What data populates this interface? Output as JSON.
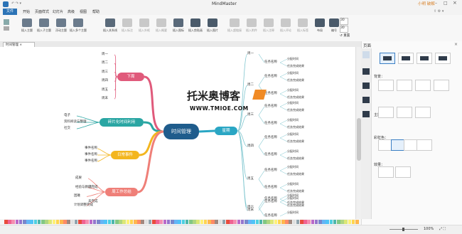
{
  "app": {
    "title": "MindMaster",
    "user": "小明 破解",
    "window_controls": [
      "minimize",
      "maximize",
      "close"
    ]
  },
  "menu": {
    "file": "文件",
    "items": [
      "开始",
      "页面样式",
      "幻灯片",
      "高级",
      "视图",
      "帮助"
    ]
  },
  "ribbon": {
    "groups": [
      {
        "label": "插入主题",
        "enabled": true
      },
      {
        "label": "插入子主题",
        "enabled": true
      },
      {
        "label": "浮动主题",
        "enabled": true
      },
      {
        "label": "插入多个主题",
        "enabled": true
      },
      {
        "label": "插入关系线",
        "enabled": true
      },
      {
        "label": "插入标注",
        "enabled": false
      },
      {
        "label": "插入外框",
        "enabled": false
      },
      {
        "label": "插入概要",
        "enabled": false
      },
      {
        "label": "插入图标",
        "enabled": true
      },
      {
        "label": "插入剪贴画",
        "enabled": true
      },
      {
        "label": "插入图片",
        "enabled": true
      },
      {
        "label": "插入超链接",
        "enabled": false
      },
      {
        "label": "插入附件",
        "enabled": false
      },
      {
        "label": "插入注释",
        "enabled": false
      },
      {
        "label": "插入评论",
        "enabled": false
      },
      {
        "label": "插入标签",
        "enabled": false
      },
      {
        "label": "布局",
        "enabled": true
      },
      {
        "label": "编号",
        "enabled": true
      }
    ],
    "spin1": "30",
    "spin2": "30",
    "reset": "重置"
  },
  "doc_tab": "时间管理",
  "mindmap": {
    "center": "时间管理",
    "left_nodes": [
      {
        "label": "下周",
        "color": "#e05a7b",
        "children": [
          "周一",
          "周二",
          "周三",
          "周四",
          "周五",
          "周末"
        ]
      },
      {
        "label": "碎片化时间利用",
        "color": "#2aa6a3",
        "children": [
          "电子",
          "资料阅读与整理",
          "社交"
        ]
      },
      {
        "label": "日常事件",
        "color": "#f3b61f",
        "children": [
          "事件名称",
          "事件名称",
          "事件名称"
        ]
      },
      {
        "label": "周工作总结",
        "color": "#ef7f78",
        "children": [
          "成果",
          "经验与教训",
          "困难",
          "计划调整完成"
        ]
      }
    ],
    "work_summary_sub": [
      "已完成",
      "未完成"
    ],
    "right_node": {
      "label": "星期",
      "color": "#2aa6c4"
    },
    "days": [
      "周一",
      "周二",
      "周三",
      "周四",
      "周五",
      "周六",
      "周末"
    ],
    "task_label": "任务名称",
    "time_label": "分配时间",
    "result_label": "任务完成结果"
  },
  "watermark": {
    "line1": "托米奥博客",
    "line2": "WWW.TMIOE.COM"
  },
  "sidebar": {
    "title": "页面",
    "sections": [
      "背景：",
      "主题：",
      "彩虹色：",
      "效果："
    ]
  },
  "status": {
    "zoom": "100%",
    "url": "https://www.tmioe.com"
  },
  "colors": {
    "accent": "#2b73b6",
    "center": "#1f5c8c"
  }
}
